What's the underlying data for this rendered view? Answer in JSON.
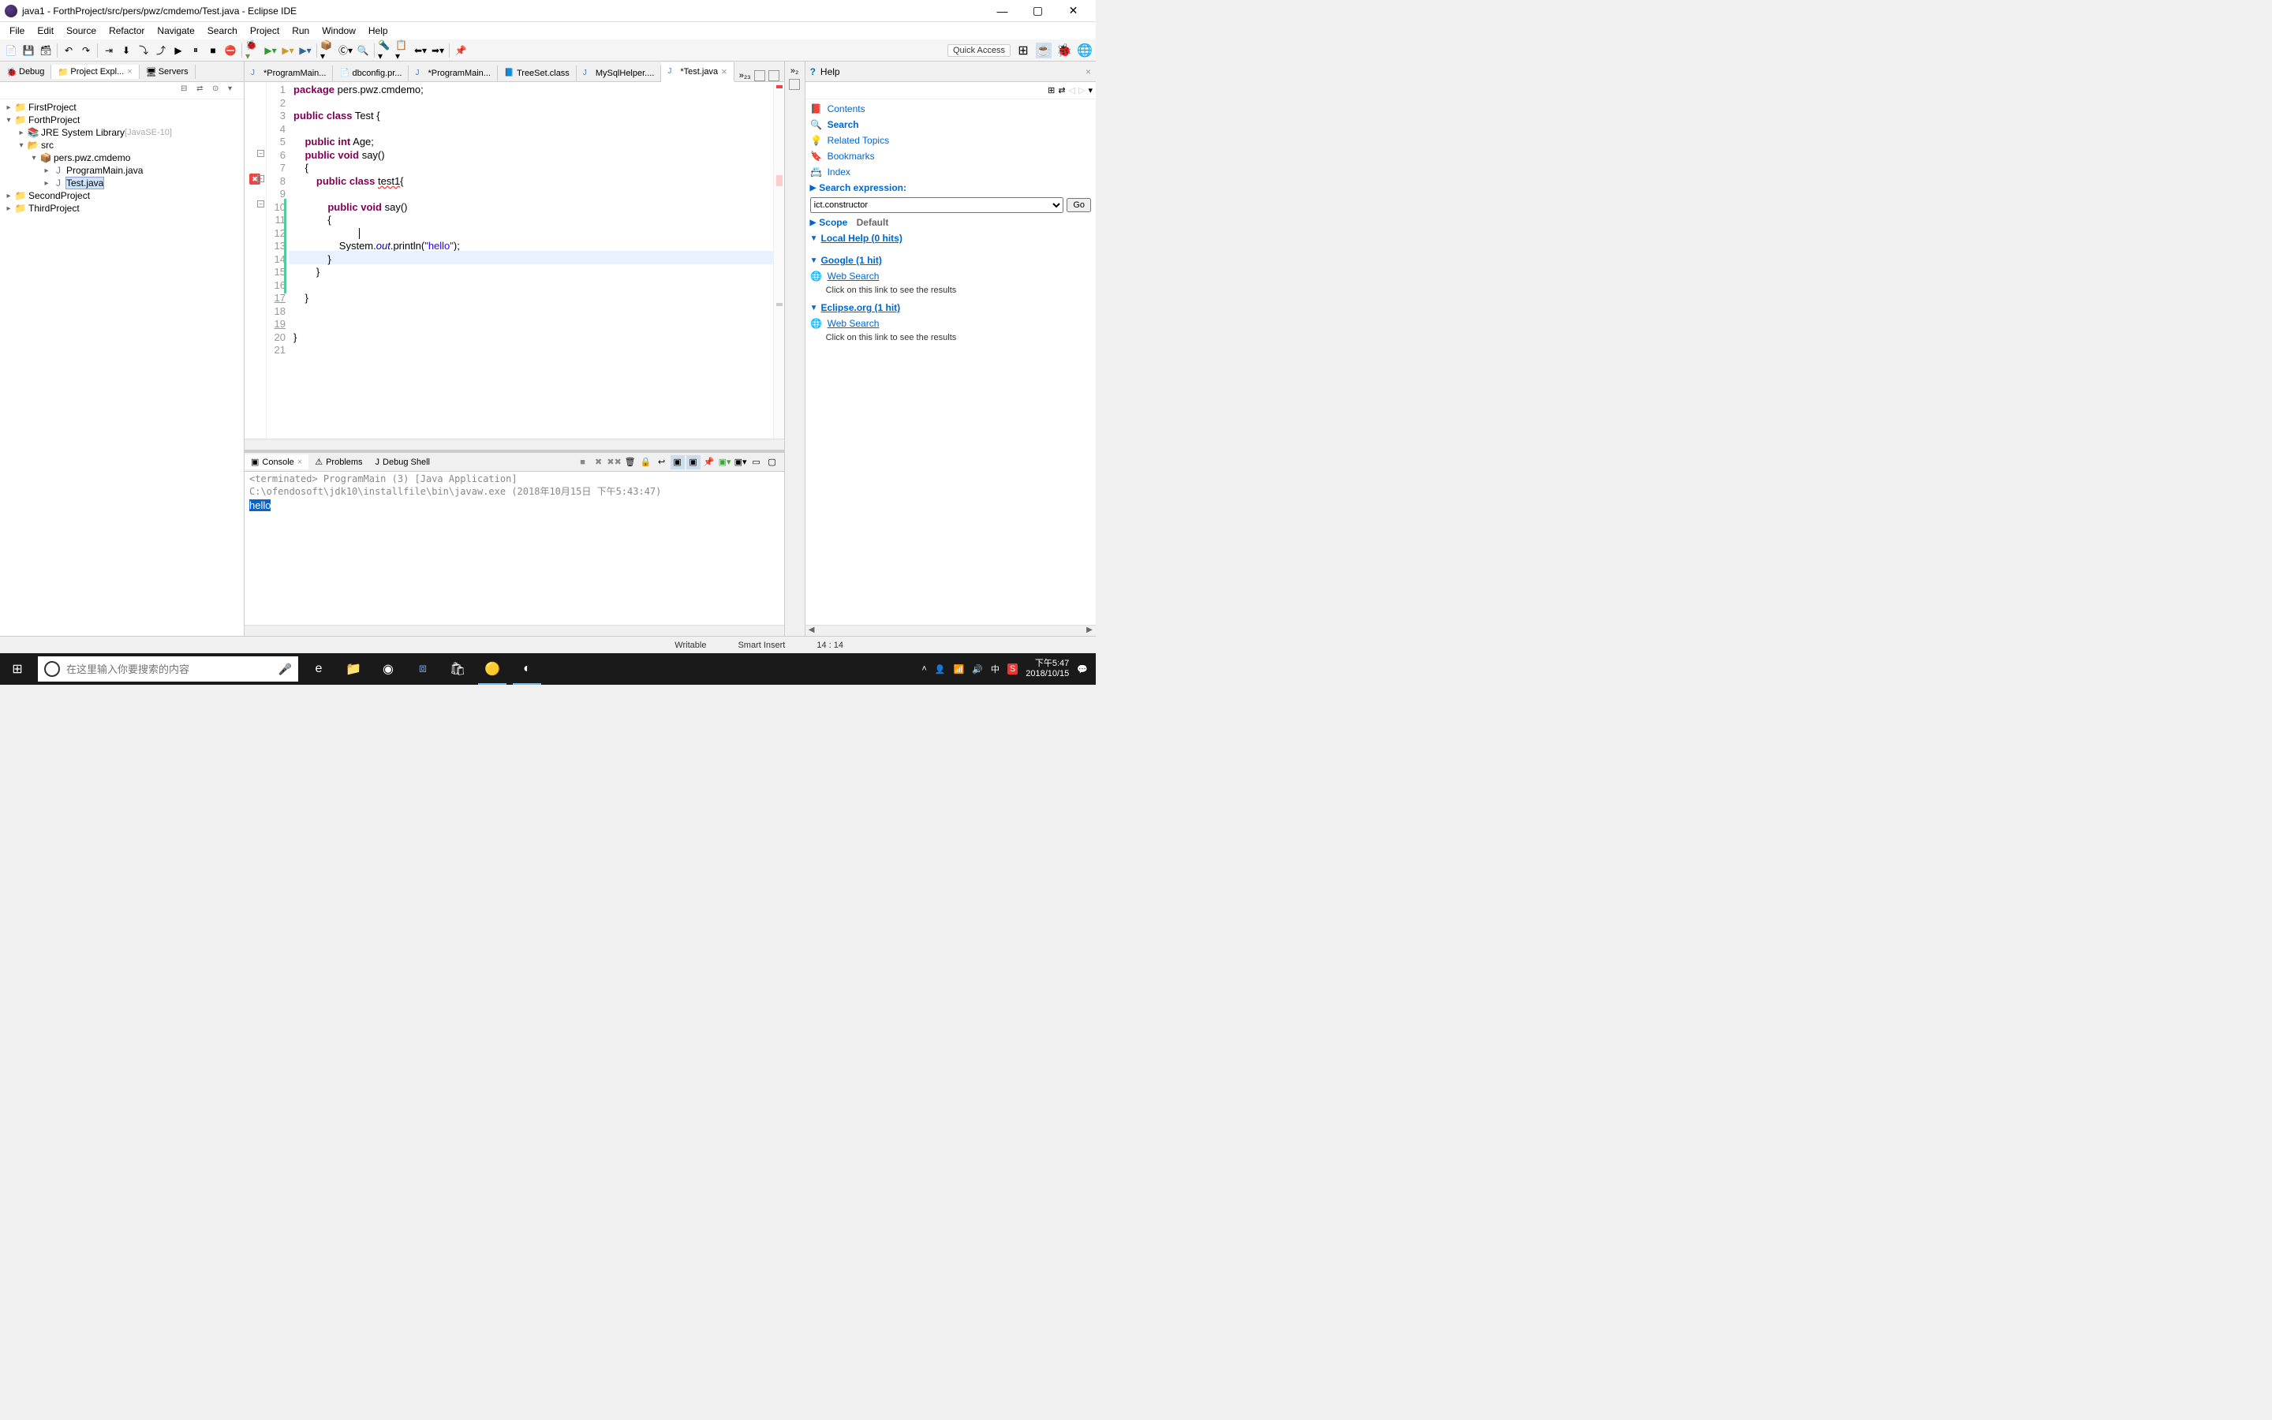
{
  "window": {
    "title": "java1 - ForthProject/src/pers/pwz/cmdemo/Test.java - Eclipse IDE"
  },
  "menu": [
    "File",
    "Edit",
    "Source",
    "Refactor",
    "Navigate",
    "Search",
    "Project",
    "Run",
    "Window",
    "Help"
  ],
  "quick_access": "Quick Access",
  "left_tabs": {
    "debug": "Debug",
    "explorer": "Project Expl...",
    "servers": "Servers"
  },
  "tree": {
    "p1": "FirstProject",
    "p2": "ForthProject",
    "jre": "JRE System Library",
    "jre_note": "[JavaSE-10]",
    "src": "src",
    "pkg": "pers.pwz.cmdemo",
    "f1": "ProgramMain.java",
    "f2": "Test.java",
    "p3": "SecondProject",
    "p4": "ThirdProject"
  },
  "editor_tabs": {
    "t1": "*ProgramMain...",
    "t2": "dbconfig.pr...",
    "t3": "*ProgramMain...",
    "t4": "TreeSet.class",
    "t5": "MySqlHelper....",
    "t6": "*Test.java",
    "more": "»₂₃"
  },
  "code": {
    "l1a": "package",
    "l1b": " pers.pwz.cmdemo;",
    "l3a": "public",
    "l3b": "class",
    "l3c": " Test {",
    "l5a": "public",
    "l5b": "int",
    "l5c": " Age;",
    "l6a": "public",
    "l6b": "void",
    "l6c": " say()",
    "l7": "{",
    "l8a": "public",
    "l8b": "class",
    "l8c": "test1",
    "l8d": "{",
    "l10a": "public",
    "l10b": "void",
    "l10c": " say()",
    "l11": "{",
    "l13a": "System.",
    "l13b": "out",
    "l13c": ".println(",
    "l13d": "\"hello\"",
    "l13e": ");",
    "l14": "}",
    "l15": "}",
    "l17": "}",
    "l20": "}"
  },
  "linenumbers": [
    "1",
    "2",
    "3",
    "4",
    "5",
    "6",
    "7",
    "8",
    "9",
    "10",
    "11",
    "12",
    "13",
    "14",
    "15",
    "16",
    "17",
    "18",
    "19",
    "20",
    "21"
  ],
  "console_tabs": {
    "console": "Console",
    "problems": "Problems",
    "debug_shell": "Debug Shell"
  },
  "console": {
    "header": "<terminated> ProgramMain (3) [Java Application] C:\\ofendosoft\\jdk10\\installfile\\bin\\javaw.exe (2018年10月15日 下午5:43:47)",
    "output": "hello"
  },
  "help": {
    "tab": "Help",
    "contents": "Contents",
    "search": "Search",
    "related": "Related Topics",
    "bookmarks": "Bookmarks",
    "index": "Index",
    "search_expr": "Search expression:",
    "expr_value": "ict.constructor",
    "go": "Go",
    "scope_label": "Scope",
    "scope_value": "Default",
    "local_help": "Local Help (0 hits)",
    "google": "Google (1 hit)",
    "web_search": "Web Search",
    "web_note": "Click on this link to see the results",
    "eclipse_org": "Eclipse.org  (1 hit)"
  },
  "status": {
    "writable": "Writable",
    "insert": "Smart Insert",
    "pos": "14 : 14"
  },
  "taskbar": {
    "search_placeholder": "在这里输入你要搜索的内容",
    "time": "下午5:47",
    "date": "2018/10/15",
    "ime": "中"
  }
}
